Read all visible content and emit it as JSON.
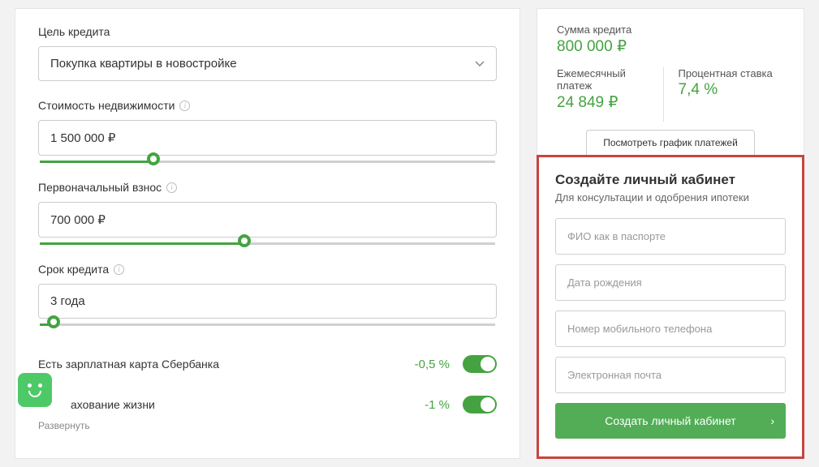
{
  "form": {
    "purpose": {
      "label": "Цель кредита",
      "value": "Покупка квартиры в новостройке"
    },
    "property_cost": {
      "label": "Стоимость недвижимости",
      "value": "1 500 000 ₽",
      "slider_percent": 25
    },
    "down_payment": {
      "label": "Первоначальный взнос",
      "value": "700 000 ₽",
      "slider_percent": 45
    },
    "term": {
      "label": "Срок кредита",
      "value": "3 года",
      "slider_percent": 3
    },
    "discounts": {
      "salary_card": {
        "label": "Есть зарплатная карта Сбербанка",
        "value": "-0,5 %"
      },
      "life_insurance": {
        "label": "ахование жизни",
        "value": "-1 %"
      },
      "expand": "Развернуть"
    }
  },
  "summary": {
    "amount": {
      "label": "Сумма кредита",
      "value": "800 000 ₽"
    },
    "monthly": {
      "label": "Ежемесячный платеж",
      "value": "24 849 ₽"
    },
    "rate": {
      "label": "Процентная ставка",
      "value": "7,4 %"
    },
    "schedule_btn": "Посмотреть график платежей"
  },
  "cabinet": {
    "title": "Создайте личный кабинет",
    "subtitle": "Для консультации и одобрения ипотеки",
    "fio_placeholder": "ФИО как в паспорте",
    "dob_placeholder": "Дата рождения",
    "phone_placeholder": "Номер мобильного телефона",
    "email_placeholder": "Электронная почта",
    "submit": "Создать личный кабинет"
  }
}
